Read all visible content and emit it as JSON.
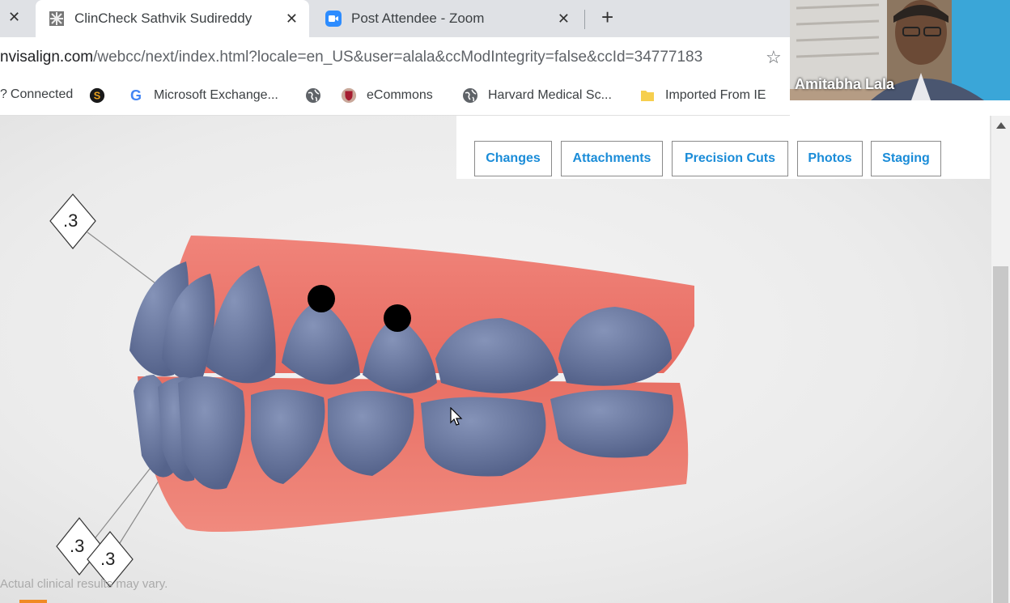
{
  "tabs": [
    {
      "title": "ClinCheck Sathvik Sudireddy",
      "active": true
    },
    {
      "title": "Post Attendee - Zoom",
      "active": false
    }
  ],
  "address": {
    "host": "nvisalign.com",
    "path": "/webcc/next/index.html?locale=en_US&user=alala&ccModIntegrity=false&ccId=34777183"
  },
  "bookmarks": [
    {
      "label": "Connected",
      "icon": "connected-icon"
    },
    {
      "label": "",
      "icon": "s-logo-icon"
    },
    {
      "label": "Microsoft Exchange...",
      "icon": "google-icon"
    },
    {
      "label": "",
      "icon": "globe-icon"
    },
    {
      "label": "eCommons",
      "icon": "harvard-shield-icon"
    },
    {
      "label": "Harvard Medical Sc...",
      "icon": "globe-icon"
    },
    {
      "label": "Imported From IE",
      "icon": "folder-icon"
    }
  ],
  "video": {
    "participant_name": "Amitabha Lala"
  },
  "toolbar": {
    "buttons": [
      "Changes",
      "Attachments",
      "Precision Cuts",
      "Photos",
      "Staging"
    ]
  },
  "annotations": {
    "upper_label": ".3",
    "lower_label_1": ".3",
    "lower_label_2": ".3"
  },
  "disclaimer": "Actual clinical results may vary.",
  "colors": {
    "gum": "#e8786c",
    "tooth": "#6f7ea6",
    "button_text": "#1a8cd8",
    "attachment": "#000000"
  }
}
